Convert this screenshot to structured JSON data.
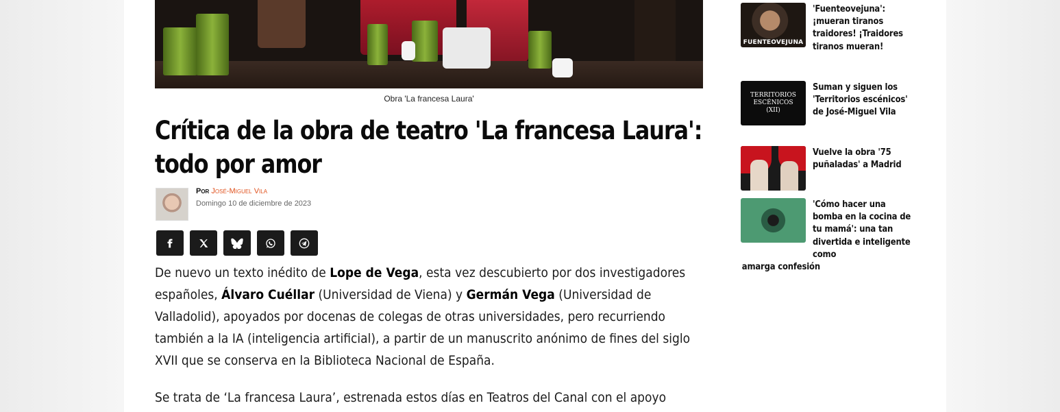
{
  "article": {
    "hero_caption": "Obra 'La francesa Laura'",
    "title": "Crítica de la obra de teatro 'La francesa Laura': todo por amor",
    "byline_prefix": "Por",
    "author": "José-Miguel Vila",
    "date": "Domingo 10 de diciembre de 2023",
    "paragraph1": [
      {
        "t": "De nuevo un texto inédito de ",
        "b": false
      },
      {
        "t": "Lope de Vega",
        "b": true
      },
      {
        "t": ", esta vez descubierto por dos investigadores españoles, ",
        "b": false
      },
      {
        "t": "Álvaro Cuéllar",
        "b": true
      },
      {
        "t": " (Universidad de Viena) y ",
        "b": false
      },
      {
        "t": "Germán Vega",
        "b": true
      },
      {
        "t": " (Universidad de Valladolid), apoyados por docenas de colegas de otras universidades, pero recurriendo también a la IA (inteligencia artificial), a partir de un manuscrito anónimo de fines del siglo XVII que se conserva en la Biblioteca Nacional de España.",
        "b": false
      }
    ],
    "paragraph2": "Se trata de ‘La francesa Laura’, estrenada estos días en Teatros del Canal con el apoyo"
  },
  "share": {
    "buttons": [
      {
        "name": "facebook",
        "icon": "facebook-icon"
      },
      {
        "name": "x",
        "icon": "x-icon"
      },
      {
        "name": "bluesky",
        "icon": "bluesky-icon"
      },
      {
        "name": "whatsapp",
        "icon": "whatsapp-icon"
      },
      {
        "name": "telegram",
        "icon": "telegram-icon"
      }
    ]
  },
  "sidebar": {
    "items": [
      {
        "title": "'Fuenteovejuna': ¡mueran tiranos traidores! ¡Traidores tiranos mueran!",
        "thumb_label": "FUENTEOVEJUNA"
      },
      {
        "title": "Suman y siguen los 'Territorios escénicos' de José-Miguel Vila",
        "thumb_label": "TERRITORIOS ESCÉNICOS (XII)"
      },
      {
        "title": "Vuelve la obra '75 puñaladas' a Madrid",
        "thumb_label": ""
      },
      {
        "title": "'Cómo hacer una bomba en la cocina de tu mamá': una tan divertida e inteligente como amarga confesión",
        "thumb_label": ""
      }
    ]
  },
  "colors": {
    "accent": "#e0521e",
    "share_bg": "#1b1b1b"
  }
}
